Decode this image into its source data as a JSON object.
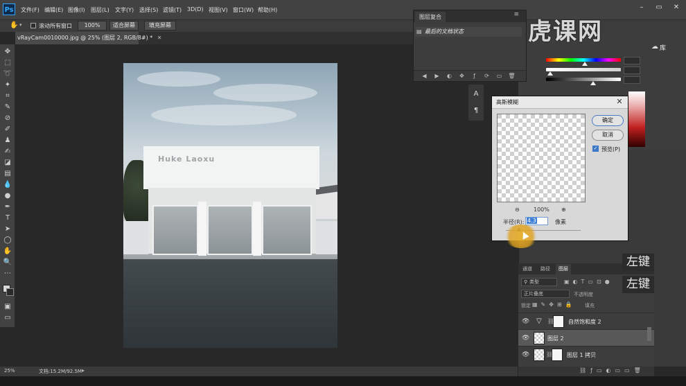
{
  "app": {
    "logo": "Ps"
  },
  "menu": [
    "文件(F)",
    "编辑(E)",
    "图像(I)",
    "图层(L)",
    "文字(Y)",
    "选择(S)",
    "滤镜(T)",
    "3D(D)",
    "视图(V)",
    "窗口(W)",
    "帮助(H)"
  ],
  "options_bar": {
    "scroll_all_label": "滚动所有窗口",
    "zoom_value": "100%",
    "fit_screen": "适合屏幕",
    "fill_screen": "填充屏幕"
  },
  "document": {
    "tab_title": "vRayCam0010000.jpg @ 25% (图层 2, RGB/8#) *",
    "sign_text": "Huke Laoxu"
  },
  "status": {
    "zoom": "25%",
    "doc_size": "文档:15.2M/92.5M"
  },
  "layer_comps": {
    "title": "图层复合",
    "item": "最后的文档状态"
  },
  "gaussian_blur": {
    "title": "高斯模糊",
    "ok": "确定",
    "cancel": "取消",
    "preview_label": "预览(P)",
    "zoom": "100%",
    "radius_label": "半径(R):",
    "radius_value": "4.3",
    "unit": "像素"
  },
  "layers_panel": {
    "tabs": [
      "通道",
      "路径",
      "图层"
    ],
    "search_label": "类型",
    "blend_mode": "正片叠底",
    "opacity_label": "不透明度",
    "lock_label": "锁定",
    "fill_label": "填充",
    "layers": [
      {
        "name": "自然饱和度 2"
      },
      {
        "name": "图层 2"
      },
      {
        "name": "图层 1 拷贝"
      }
    ]
  },
  "library_label": "库",
  "watermark": "虎课网",
  "captions": [
    "左键",
    "左键"
  ],
  "colors": {
    "accent": "#31a8ff",
    "halo": "#e9af28"
  }
}
